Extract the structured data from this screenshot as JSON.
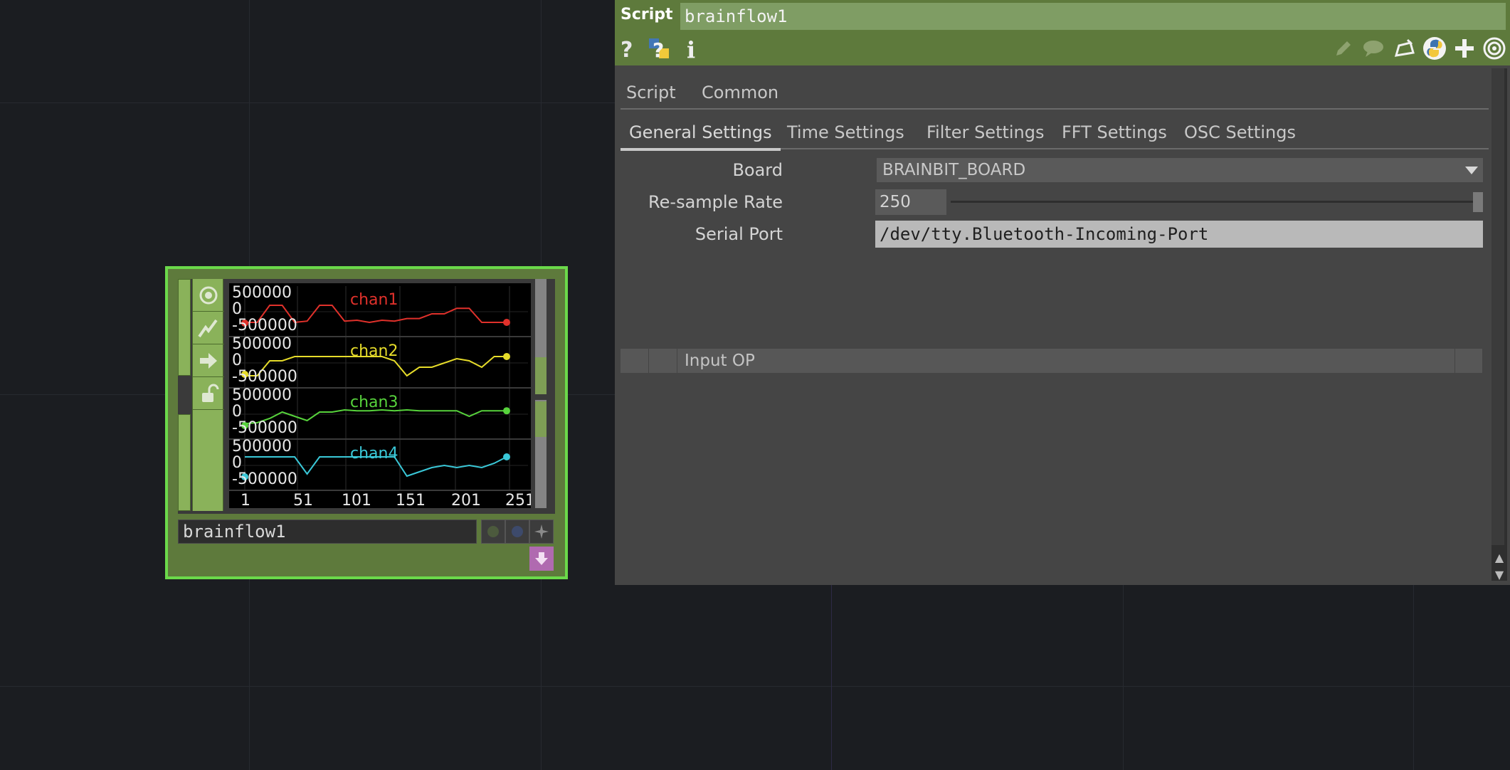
{
  "node": {
    "name": "brainflow1",
    "viewer": {
      "ymax_label": "500000",
      "yzero_label": "0",
      "ymin_label": "-500000",
      "x_ticks": [
        "1",
        "51",
        "101",
        "151",
        "201",
        "251"
      ],
      "channels": [
        {
          "name": "chan1",
          "color": "#e0312b"
        },
        {
          "name": "chan2",
          "color": "#e6dc2a"
        },
        {
          "name": "chan3",
          "color": "#57d33c"
        },
        {
          "name": "chan4",
          "color": "#3ac8d8"
        }
      ]
    }
  },
  "panel": {
    "op_type": "Script",
    "op_name": "brainflow1",
    "page_tabs": [
      "Script",
      "Common"
    ],
    "settings_tabs": [
      "General Settings",
      "Time Settings",
      "Filter Settings",
      "FFT Settings",
      "OSC Settings"
    ],
    "params": {
      "board_label": "Board",
      "board_value": "BRAINBIT_BOARD",
      "resample_label": "Re-sample Rate",
      "resample_value": "250",
      "serial_label": "Serial Port",
      "serial_value": "/dev/tty.Bluetooth-Incoming-Port"
    },
    "input_op_label": "Input OP"
  },
  "icons": {
    "help": "question-icon",
    "python_help": "python-help-icon",
    "info": "info-icon",
    "edit": "pencil-icon",
    "comment": "comment-icon",
    "clone": "clone-icon",
    "python": "python-icon",
    "add": "plus-icon",
    "target": "target-icon"
  }
}
